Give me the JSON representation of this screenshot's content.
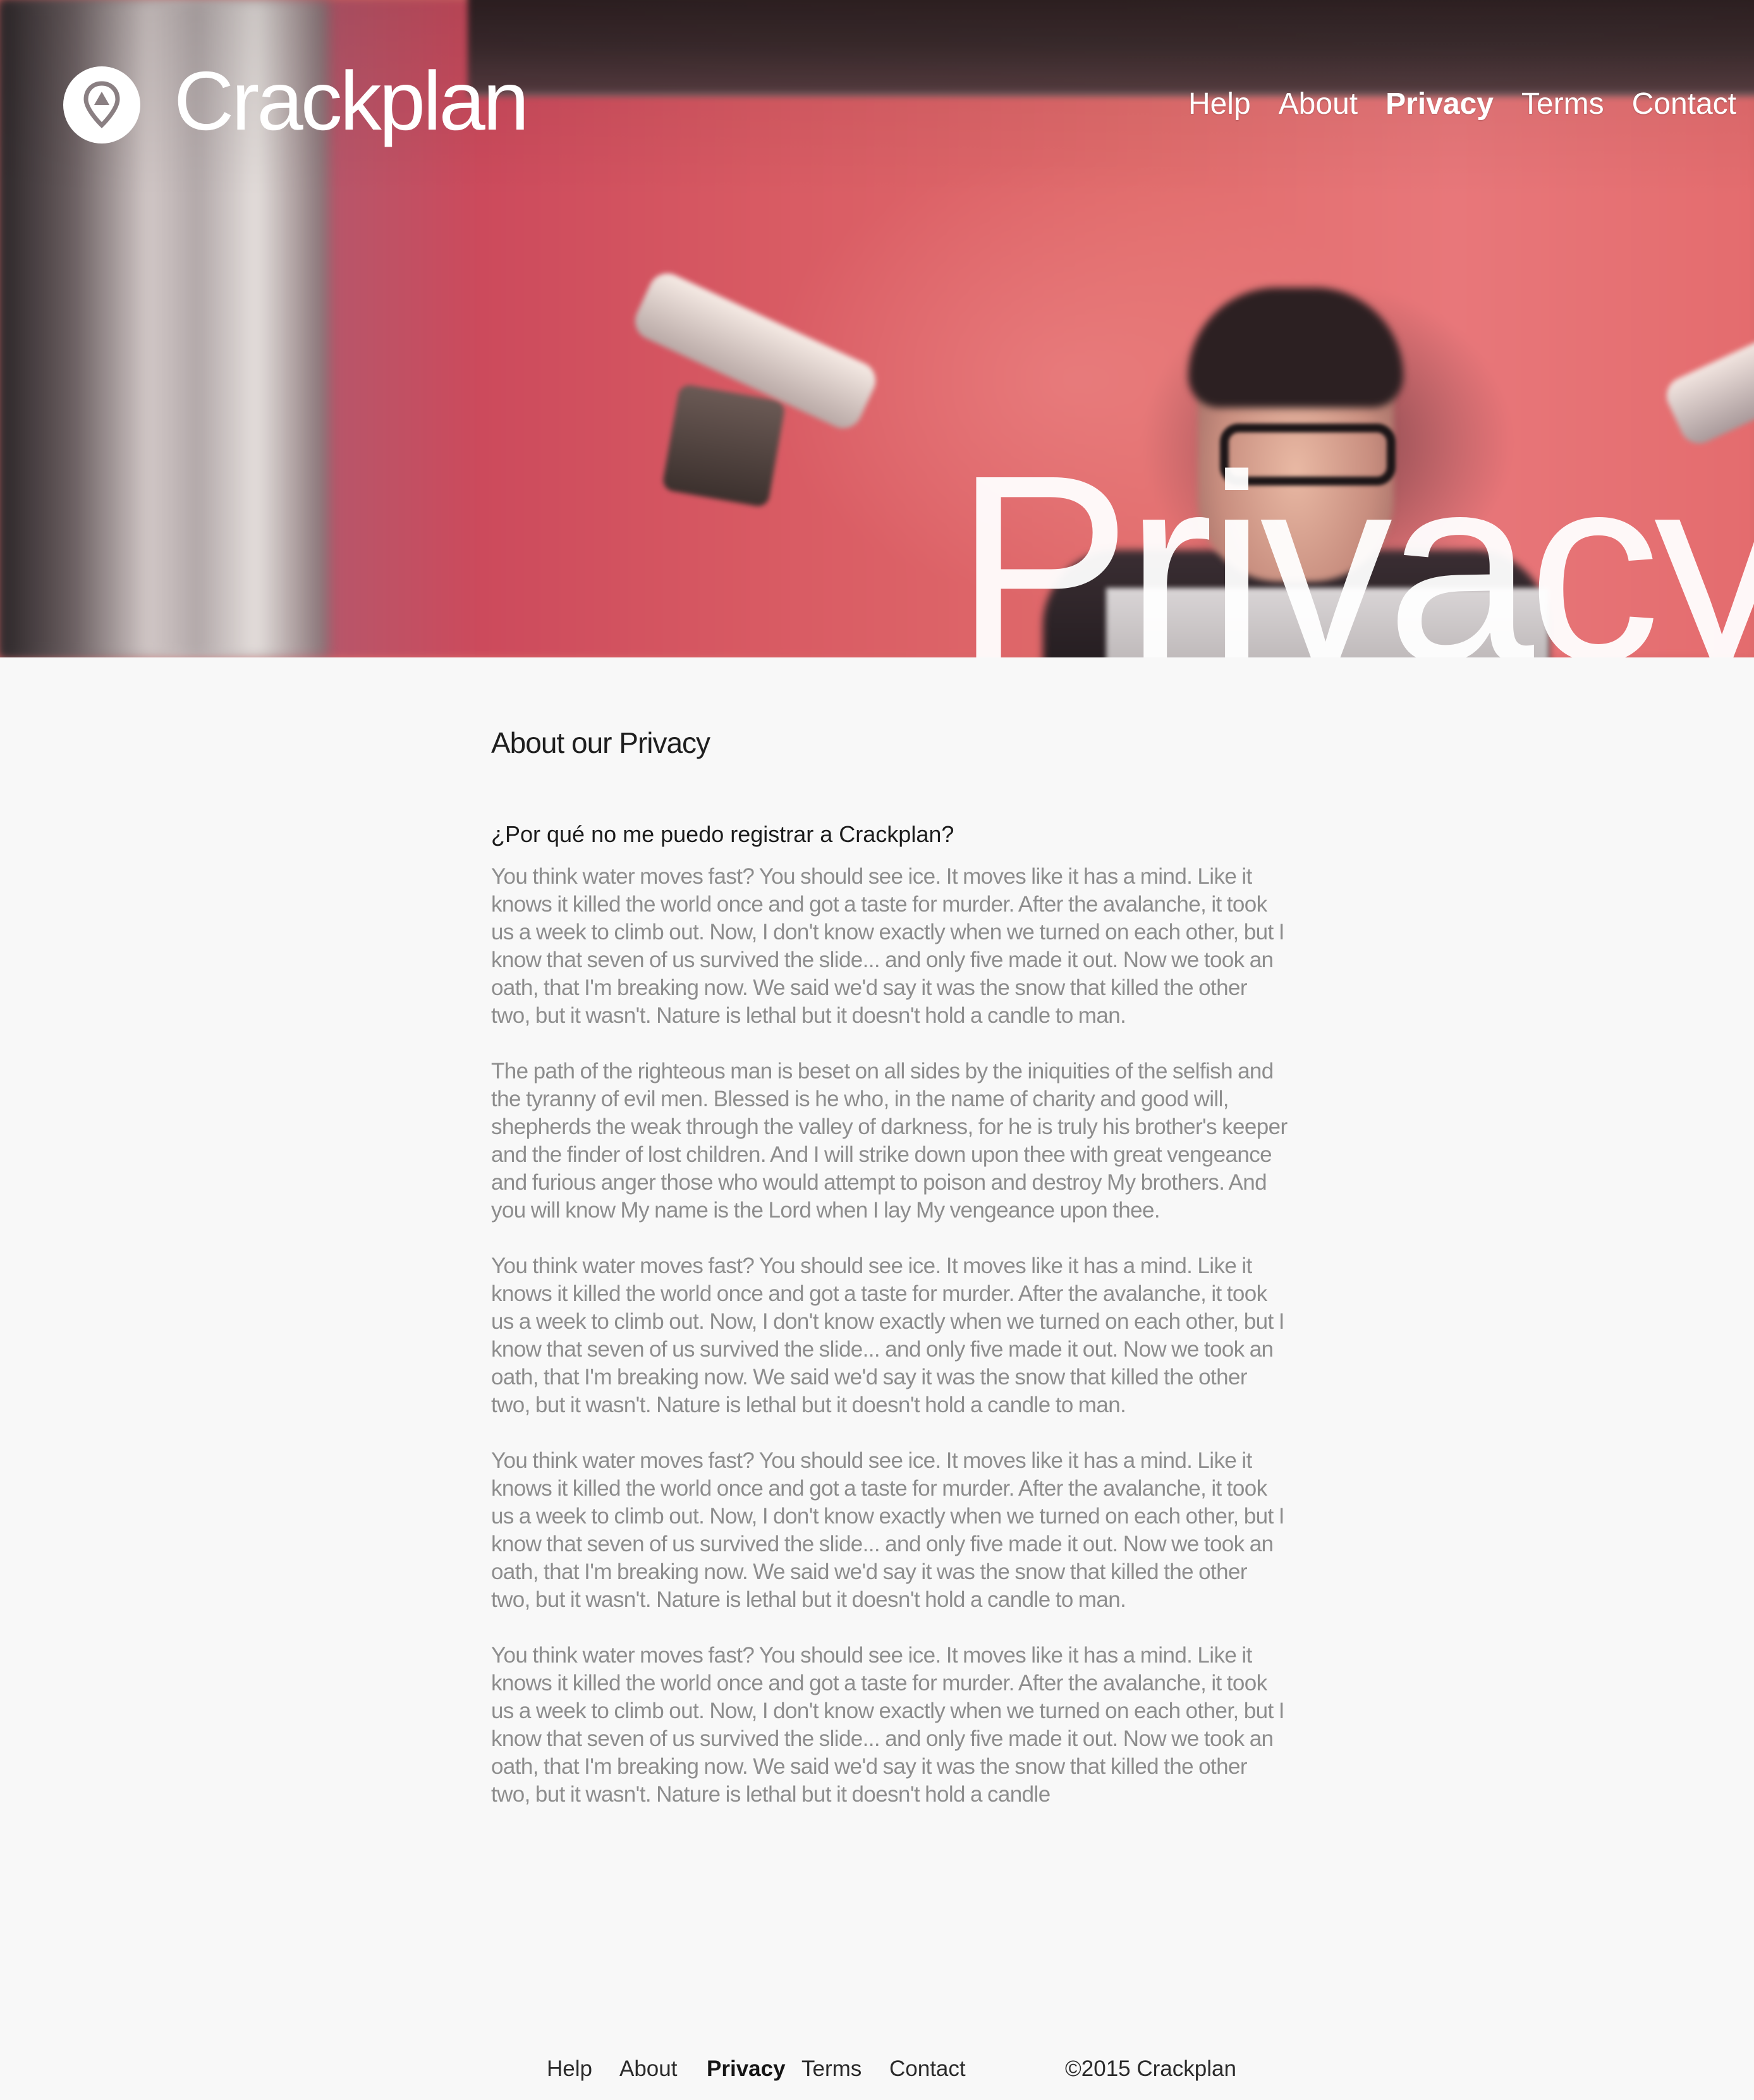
{
  "brand": {
    "name": "Crackplan"
  },
  "nav": {
    "items": [
      {
        "label": "Help"
      },
      {
        "label": "About"
      },
      {
        "label": "Privacy"
      },
      {
        "label": "Terms"
      },
      {
        "label": "Contact"
      }
    ]
  },
  "hero": {
    "title": "Privacy"
  },
  "content": {
    "heading": "About our Privacy",
    "subheading": "¿Por qué no me puedo registrar a Crackplan?",
    "paragraphs": [
      "You think water moves fast? You should see ice. It moves like it has a mind. Like it knows it killed the world once and got a taste for murder. After the avalanche, it took us a week to climb out. Now, I don't know exactly when we turned on each other, but I know that seven of us survived the slide... and only five made it out. Now we took an oath, that I'm breaking now. We said we'd say it was the snow that killed the other two, but it wasn't. Nature is lethal but it doesn't hold a candle to man.",
      "The path of the righteous man is beset on all sides by the iniquities of the selfish and the tyranny of evil men. Blessed is he who, in the name of charity and good will, shepherds the weak through the valley of darkness, for he is truly his brother's keeper and the finder of lost children. And I will strike down upon thee with great vengeance and furious anger those who would attempt to poison and destroy My brothers. And you will know My name is the Lord when I lay My vengeance upon thee.",
      "You think water moves fast? You should see ice. It moves like it has a mind. Like it knows it killed the world once and got a taste for murder. After the avalanche, it took us a week to climb out. Now, I don't know exactly when we turned on each other, but I know that seven of us survived the slide... and only five made it out. Now we took an oath, that I'm breaking now. We said we'd say it was the snow that killed the other two, but it wasn't. Nature is lethal but it doesn't hold a candle to man.",
      "You think water moves fast? You should see ice. It moves like it has a mind. Like it knows it killed the world once and got a taste for murder. After the avalanche, it took us a week to climb out. Now, I don't know exactly when we turned on each other, but I know that seven of us survived the slide... and only five made it out. Now we took an oath, that I'm breaking now. We said we'd say it was the snow that killed the other two, but it wasn't. Nature is lethal but it doesn't hold a candle to man.",
      "You think water moves fast? You should see ice. It moves like it has a mind. Like it knows it killed the world once and got a taste for murder. After the avalanche, it took us a week to climb out. Now, I don't know exactly when we turned on each other, but I know that seven of us survived the slide... and only five made it out. Now we took an oath, that I'm breaking now. We said we'd say it was the snow that killed the other two, but it wasn't. Nature is lethal but it doesn't hold a candle"
    ]
  },
  "footer": {
    "links": [
      {
        "label": "Help"
      },
      {
        "label": "About"
      },
      {
        "label": "Privacy"
      },
      {
        "label": "Terms"
      },
      {
        "label": "Contact"
      }
    ],
    "copyright": "©2015 Crackplan"
  },
  "colors": {
    "accent_red": "#d95b63",
    "page_background": "#f8f8f8",
    "body_text": "#8d8d8d",
    "heading_text": "#1f1f1f"
  },
  "icons": {
    "logo": "map-pin-icon"
  }
}
